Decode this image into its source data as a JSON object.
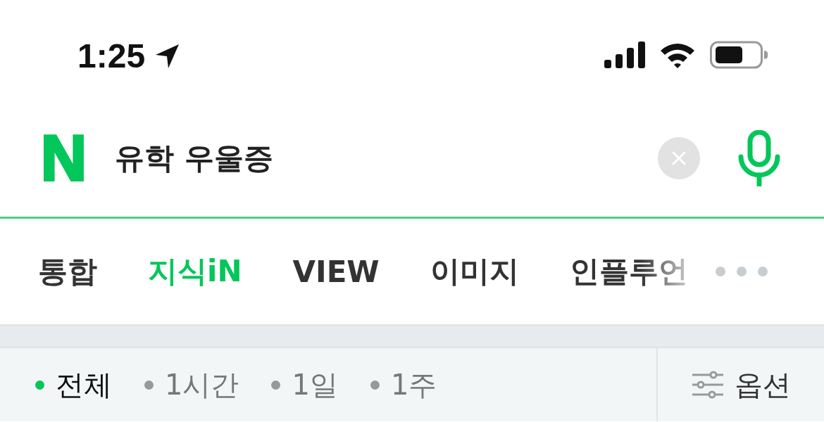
{
  "status_bar": {
    "time": "1:25"
  },
  "search": {
    "logo": "N",
    "query": "유학 우울증"
  },
  "tabs": [
    {
      "label": "통합",
      "selected": false
    },
    {
      "label": "지식iN",
      "selected": true
    },
    {
      "label": "VIEW",
      "selected": false
    },
    {
      "label": "이미지",
      "selected": false
    },
    {
      "label": "인플루언",
      "selected": false
    }
  ],
  "filters": [
    {
      "label": "전체",
      "selected": true
    },
    {
      "label": "1시간",
      "selected": false
    },
    {
      "label": "1일",
      "selected": false
    },
    {
      "label": "1주",
      "selected": false
    }
  ],
  "options_button": {
    "label": "옵션"
  }
}
